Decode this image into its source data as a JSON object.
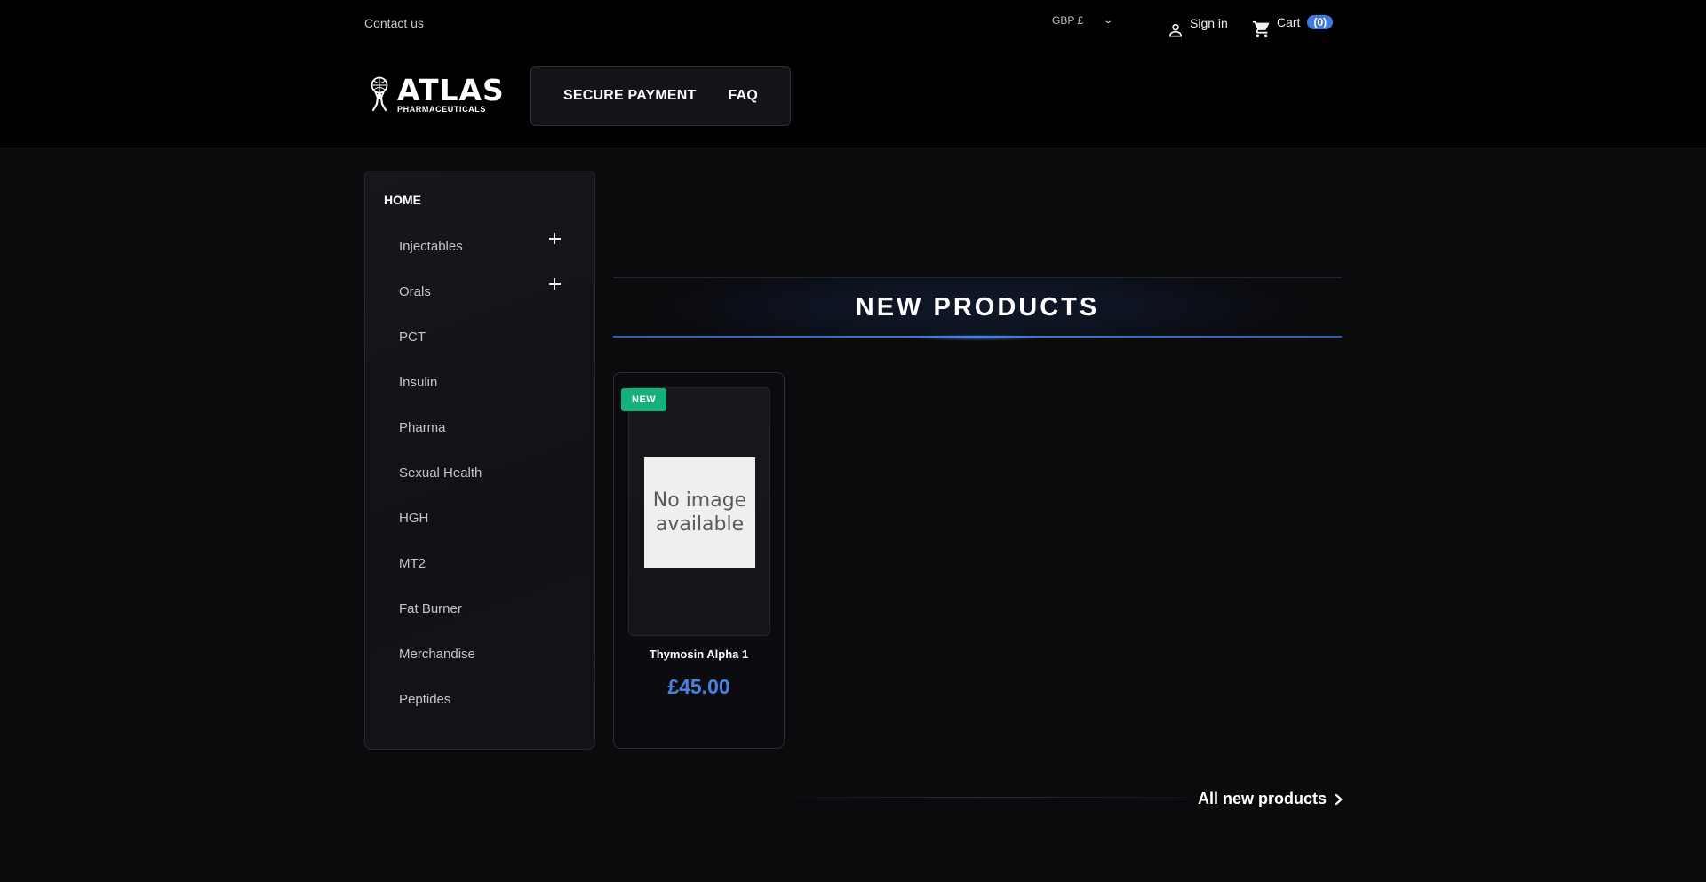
{
  "header": {
    "contact_label": "Contact us",
    "currency": "GBP £",
    "signin_label": "Sign in",
    "cart_label": "Cart",
    "cart_count": "(0)",
    "logo_main": "ATLAS",
    "logo_sub": "PHARMACEUTICALS",
    "nav": [
      {
        "label": "SECURE PAYMENT"
      },
      {
        "label": "FAQ"
      }
    ]
  },
  "sidebar": {
    "home_label": "HOME",
    "items": [
      {
        "label": "Injectables",
        "expandable": true
      },
      {
        "label": "Orals",
        "expandable": true
      },
      {
        "label": "PCT"
      },
      {
        "label": "Insulin"
      },
      {
        "label": "Pharma"
      },
      {
        "label": "Sexual Health"
      },
      {
        "label": "HGH"
      },
      {
        "label": "MT2"
      },
      {
        "label": "Fat Burner"
      },
      {
        "label": "Merchandise"
      },
      {
        "label": "Peptides"
      }
    ]
  },
  "section": {
    "title": "NEW PRODUCTS",
    "all_link": "All new products"
  },
  "products": [
    {
      "badge": "NEW",
      "image_text_line1": "No image",
      "image_text_line2": "available",
      "name": "Thymosin Alpha 1",
      "price": "£45.00"
    }
  ],
  "colors": {
    "accent": "#3d7be0",
    "price": "#4a82e0",
    "badge_new": "#14b27a",
    "background": "#0b0b0e"
  }
}
